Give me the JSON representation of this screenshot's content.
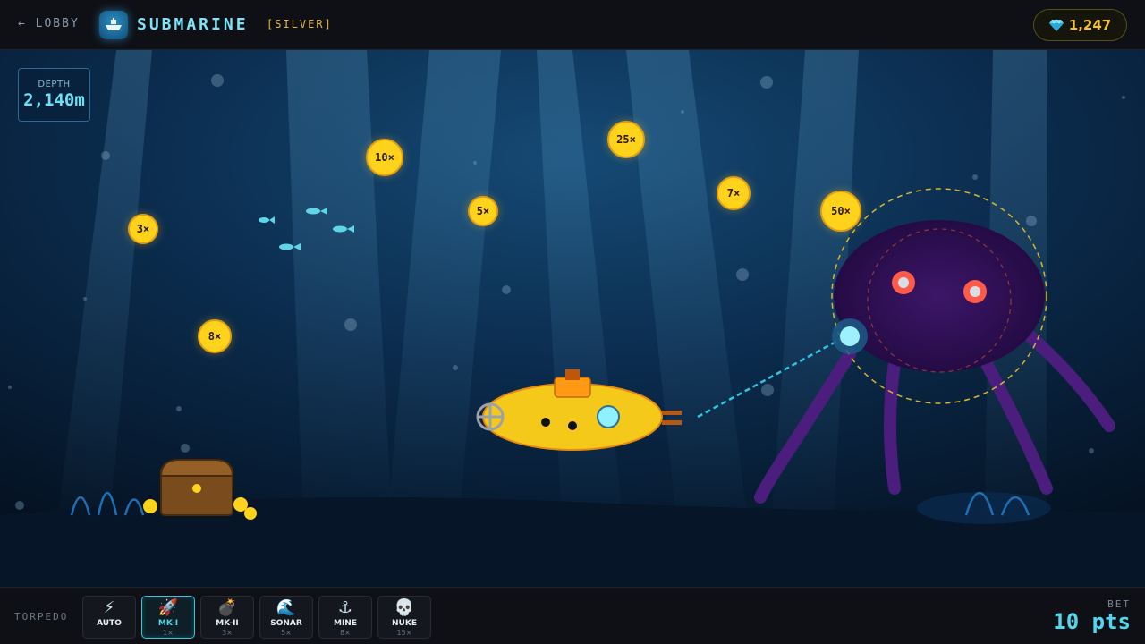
{
  "header": {
    "back_label": "← LOBBY",
    "title": "SUBMARINE",
    "tier": "[SILVER]",
    "balance": "1,247",
    "balance_icon": "gem-icon"
  },
  "hud": {
    "depth_label": "DEPTH",
    "depth_value": "2,140m"
  },
  "targets": [
    {
      "label": "3×"
    },
    {
      "label": "10×"
    },
    {
      "label": "5×"
    },
    {
      "label": "25×"
    },
    {
      "label": "7×"
    },
    {
      "label": "50×"
    },
    {
      "label": "8×"
    }
  ],
  "loadout": {
    "label": "TORPEDO",
    "weapons": [
      {
        "name": "AUTO",
        "mult": "",
        "icon": "lightning-icon",
        "glyph": "⚡"
      },
      {
        "name": "MK-I",
        "mult": "1×",
        "icon": "rocket-icon",
        "glyph": "🚀"
      },
      {
        "name": "MK-II",
        "mult": "3×",
        "icon": "bomb-icon",
        "glyph": "💣"
      },
      {
        "name": "SONAR",
        "mult": "5×",
        "icon": "wave-icon",
        "glyph": "🌊"
      },
      {
        "name": "MINE",
        "mult": "8×",
        "icon": "anchor-icon",
        "glyph": "⚓"
      },
      {
        "name": "NUKE",
        "mult": "15×",
        "icon": "skull-icon",
        "glyph": "💀"
      }
    ],
    "selected": "MK-I"
  },
  "bet": {
    "label": "BET",
    "value": "10 pts"
  },
  "colors": {
    "accent": "#53d7ec",
    "coin": "#ffd21c",
    "gold": "#f2c230",
    "octopus": "#3b1663"
  }
}
